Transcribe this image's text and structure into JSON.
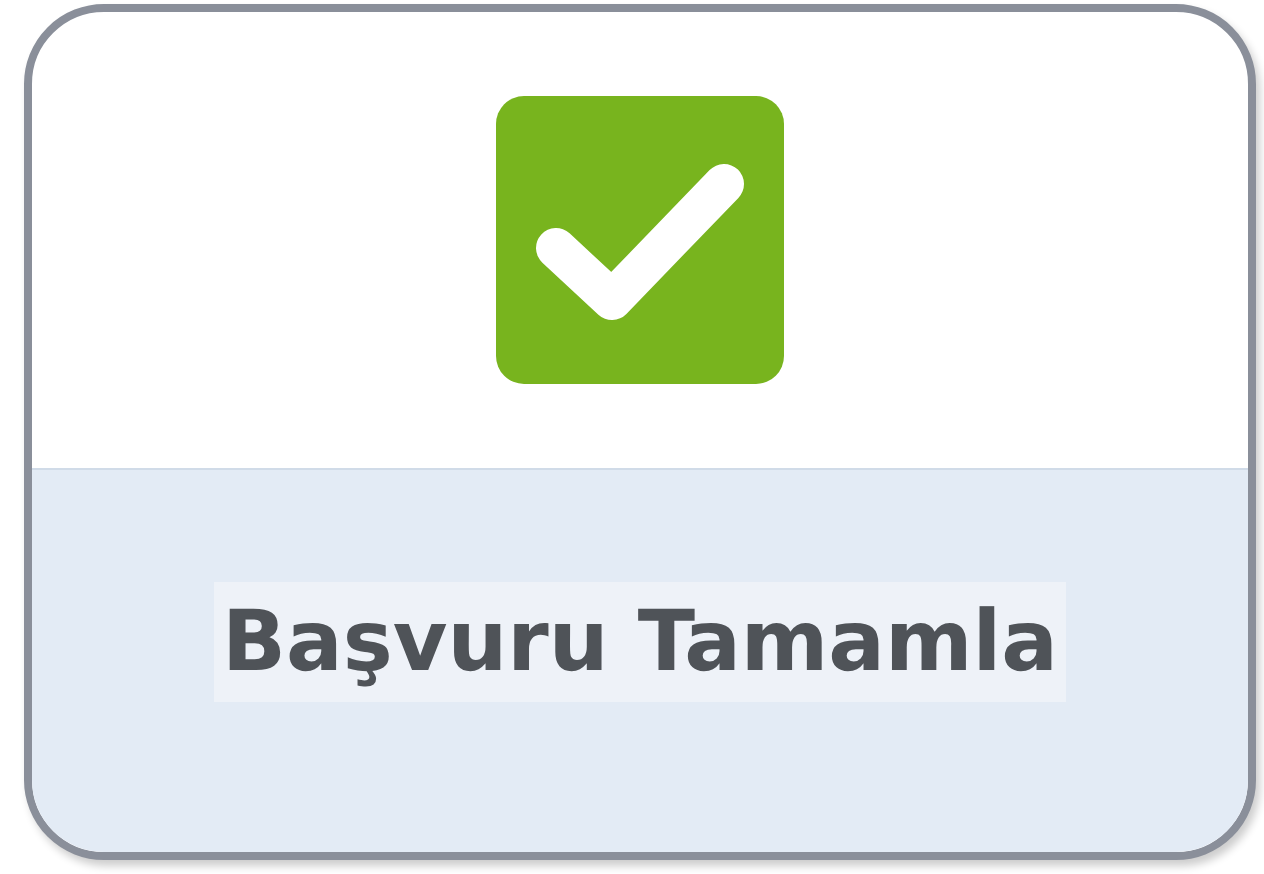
{
  "tile": {
    "label": "Başvuru Tamamla"
  }
}
